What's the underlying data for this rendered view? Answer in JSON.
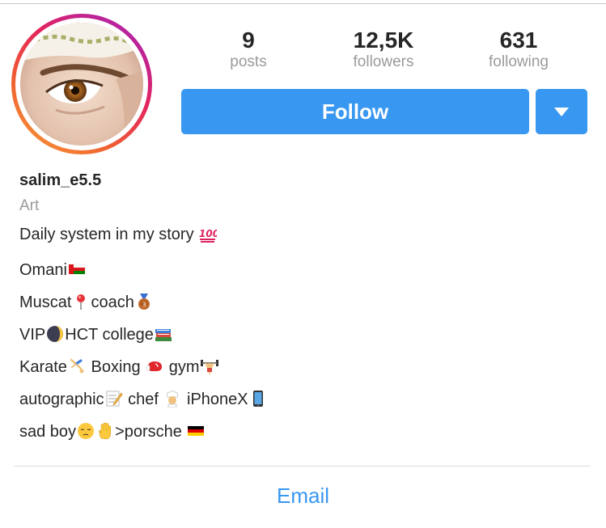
{
  "profile": {
    "stats": {
      "posts": {
        "value": "9",
        "label": "posts"
      },
      "followers": {
        "value": "12,5K",
        "label": "followers"
      },
      "following": {
        "value": "631",
        "label": "following"
      }
    },
    "follow_label": "Follow",
    "dropdown_icon": "caret-down-icon",
    "username": "salim_e5.5",
    "category": "Art",
    "bio_lines": [
      {
        "parts": [
          "Daily system in my story "
        ],
        "icons": [
          "hundred-points-icon"
        ]
      },
      {
        "parts": [
          "Omani"
        ],
        "icons": [
          "oman-flag-icon"
        ]
      },
      {
        "parts": [
          "Muscat",
          "coach"
        ],
        "icons": [
          "pin-icon",
          "bronze-medal-icon"
        ]
      },
      {
        "parts": [
          "VIP",
          "HCT college"
        ],
        "icons": [
          "moon-icon",
          "books-icon"
        ]
      },
      {
        "parts": [
          "Karate",
          " Boxing ",
          " gym"
        ],
        "icons": [
          "gymnast-icon",
          "boxing-glove-icon",
          "weightlifter-icon"
        ]
      },
      {
        "parts": [
          "autographic",
          " chef ",
          " iPhoneX"
        ],
        "icons": [
          "memo-icon",
          "chef-icon",
          "phone-icon"
        ]
      },
      {
        "parts": [
          "sad boy",
          ">porsche "
        ],
        "icons": [
          "pensive-face-icon",
          "raised-hand-icon",
          "germany-flag-icon"
        ]
      }
    ],
    "email_label": "Email"
  },
  "colors": {
    "accent": "#3897f0",
    "text": "#262626",
    "muted": "#9a9a9a"
  }
}
